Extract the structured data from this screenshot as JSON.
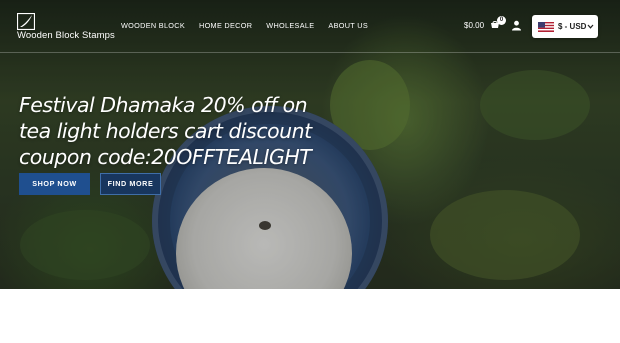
{
  "brand": {
    "name": "Wooden Block Stamps"
  },
  "nav": {
    "items": [
      {
        "label": "WOODEN BLOCK"
      },
      {
        "label": "HOME DECOR"
      },
      {
        "label": "WHOLESALE"
      },
      {
        "label": "ABOUT US"
      }
    ]
  },
  "cart": {
    "total": "$0.00",
    "count": "0"
  },
  "currency": {
    "label": "$ - USD"
  },
  "hero": {
    "headline": "Festival Dhamaka 20% off on tea light holders cart discount coupon code:20OFFTEALIGHT",
    "shop_now": "SHOP NOW",
    "find_more": "FIND MORE"
  }
}
